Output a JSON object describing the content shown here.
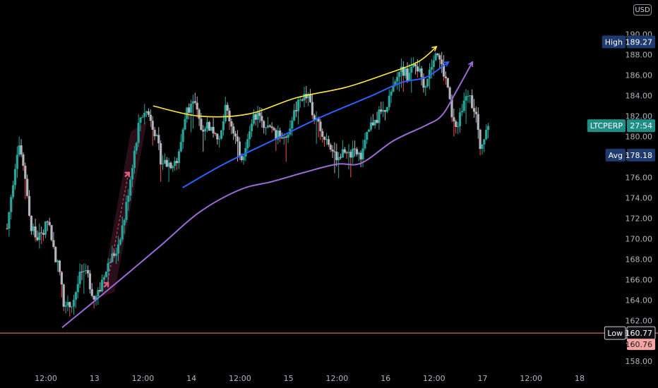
{
  "currency_button": "USD",
  "symbol": "LTCPERP",
  "timer": "27:54",
  "markers": {
    "high": {
      "label": "High",
      "value": "189.27"
    },
    "avg": {
      "label": "Avg",
      "value": "178.18"
    },
    "low": {
      "label": "Low",
      "value": "160.77"
    },
    "low_price": "160.76",
    "last_price": "181.07"
  },
  "colors": {
    "background": "#000000",
    "up": "#26a69a",
    "down": "#b2b5be",
    "wick_down": "#ef5350",
    "axis_text": "#b2b5be",
    "high_tag": "#1e3a6e",
    "price_tag": "#1f8e84",
    "low_line": "#f28b82",
    "low_tag_red": "#f5a3a3",
    "curve_yellow": "#ffeb3b",
    "curve_blue": "#2962ff",
    "curve_purple": "#9c6bd6",
    "arrow_pink": "#d95f7a"
  },
  "chart_data": {
    "type": "candlestick",
    "symbol": "LTCPERP",
    "ylim": [
      157.5,
      191
    ],
    "y_ticks": [
      "158.00",
      "160.00",
      "162.00",
      "164.00",
      "166.00",
      "168.00",
      "170.00",
      "172.00",
      "174.00",
      "176.00",
      "178.00",
      "180.00",
      "182.00",
      "184.00",
      "186.00",
      "188.00",
      "190.00"
    ],
    "x_ticks": [
      "12:00",
      "13",
      "12:00",
      "14",
      "12:00",
      "15",
      "12:00",
      "16",
      "12:00",
      "17",
      "12:00",
      "18"
    ],
    "x_tick_hours": [
      12,
      24,
      36,
      48,
      60,
      72,
      84,
      96,
      108,
      120,
      132,
      144
    ],
    "xlim_hours": [
      2.4,
      161.4
    ],
    "price_path": [
      [
        2.4,
        171.0
      ],
      [
        3.5,
        174.5
      ],
      [
        5.2,
        179.6
      ],
      [
        6.5,
        177.0
      ],
      [
        8.0,
        171.6
      ],
      [
        9.5,
        170.1
      ],
      [
        11.0,
        170.3
      ],
      [
        12.6,
        171.9
      ],
      [
        14.0,
        168.8
      ],
      [
        15.5,
        166.6
      ],
      [
        16.5,
        163.1
      ],
      [
        18.5,
        163.6
      ],
      [
        20.5,
        166.4
      ],
      [
        22.0,
        166.9
      ],
      [
        23.8,
        164.2
      ],
      [
        25.5,
        165.0
      ],
      [
        27.5,
        167.8
      ],
      [
        29.5,
        168.9
      ],
      [
        31.5,
        172.2
      ],
      [
        33.5,
        177.6
      ],
      [
        35.2,
        181.8
      ],
      [
        36.6,
        182.6
      ],
      [
        38.0,
        181.8
      ],
      [
        39.5,
        179.6
      ],
      [
        40.5,
        177.6
      ],
      [
        42.5,
        177.4
      ],
      [
        44.5,
        177.2
      ],
      [
        45.0,
        178.5
      ],
      [
        46.5,
        182.3
      ],
      [
        48.5,
        183.6
      ],
      [
        50.3,
        180.8
      ],
      [
        52.0,
        181.2
      ],
      [
        53.5,
        180.5
      ],
      [
        54.9,
        179.3
      ],
      [
        56.5,
        182.8
      ],
      [
        58.5,
        180.5
      ],
      [
        60.5,
        177.7
      ],
      [
        62.3,
        180.9
      ],
      [
        64.0,
        182.2
      ],
      [
        65.5,
        181.6
      ],
      [
        67.5,
        180.6
      ],
      [
        70.0,
        180.0
      ],
      [
        72.0,
        180.3
      ],
      [
        73.5,
        182.4
      ],
      [
        75.0,
        183.6
      ],
      [
        76.8,
        184.3
      ],
      [
        78.0,
        182.0
      ],
      [
        80.5,
        180.1
      ],
      [
        82.5,
        179.2
      ],
      [
        84.0,
        178.1
      ],
      [
        86.0,
        178.4
      ],
      [
        88.5,
        178.3
      ],
      [
        90.0,
        178.3
      ],
      [
        92.5,
        181.2
      ],
      [
        94.0,
        181.9
      ],
      [
        96.0,
        183.0
      ],
      [
        98.0,
        184.6
      ],
      [
        99.5,
        186.6
      ],
      [
        101.5,
        186.0
      ],
      [
        103.5,
        186.9
      ],
      [
        104.5,
        186.3
      ],
      [
        105.5,
        184.3
      ],
      [
        107.0,
        186.6
      ],
      [
        108.5,
        188.7
      ],
      [
        109.8,
        187.0
      ],
      [
        111.4,
        184.8
      ],
      [
        112.5,
        181.4
      ],
      [
        113.5,
        180.8
      ],
      [
        115.0,
        183.2
      ],
      [
        116.5,
        184.2
      ],
      [
        117.5,
        183.2
      ],
      [
        118.5,
        181.9
      ],
      [
        119.2,
        178.9
      ],
      [
        120.5,
        179.9
      ],
      [
        121.5,
        181.07
      ]
    ],
    "overlays": {
      "yellow_curve": [
        [
          38.5,
          183.0
        ],
        [
          50,
          182.0
        ],
        [
          62,
          182.2
        ],
        [
          74,
          183.8
        ],
        [
          86,
          184.8
        ],
        [
          96,
          186.1
        ],
        [
          104,
          187.3
        ],
        [
          108.6,
          188.8
        ]
      ],
      "blue_line": [
        [
          45.8,
          175.0
        ],
        [
          56,
          177.3
        ],
        [
          68,
          179.6
        ],
        [
          80,
          181.9
        ],
        [
          92,
          183.9
        ],
        [
          100,
          185.3
        ],
        [
          106,
          185.8
        ],
        [
          111.6,
          187.3
        ]
      ],
      "purple_curve": [
        [
          16,
          161.3
        ],
        [
          28,
          165.2
        ],
        [
          40,
          169.2
        ],
        [
          50,
          172.6
        ],
        [
          60,
          174.8
        ],
        [
          68,
          175.6
        ],
        [
          76,
          176.5
        ],
        [
          84,
          177.3
        ],
        [
          90,
          177.4
        ],
        [
          98,
          179.6
        ],
        [
          106,
          181.1
        ],
        [
          110,
          182.1
        ],
        [
          113.6,
          184.5
        ],
        [
          117.5,
          187.3
        ]
      ],
      "arrows": [
        [
          27.2,
          165.6
        ],
        [
          32.4,
          176.4
        ]
      ]
    },
    "markers": {
      "high": 189.27,
      "avg": 178.18,
      "low": 160.77,
      "last": 181.07
    }
  }
}
